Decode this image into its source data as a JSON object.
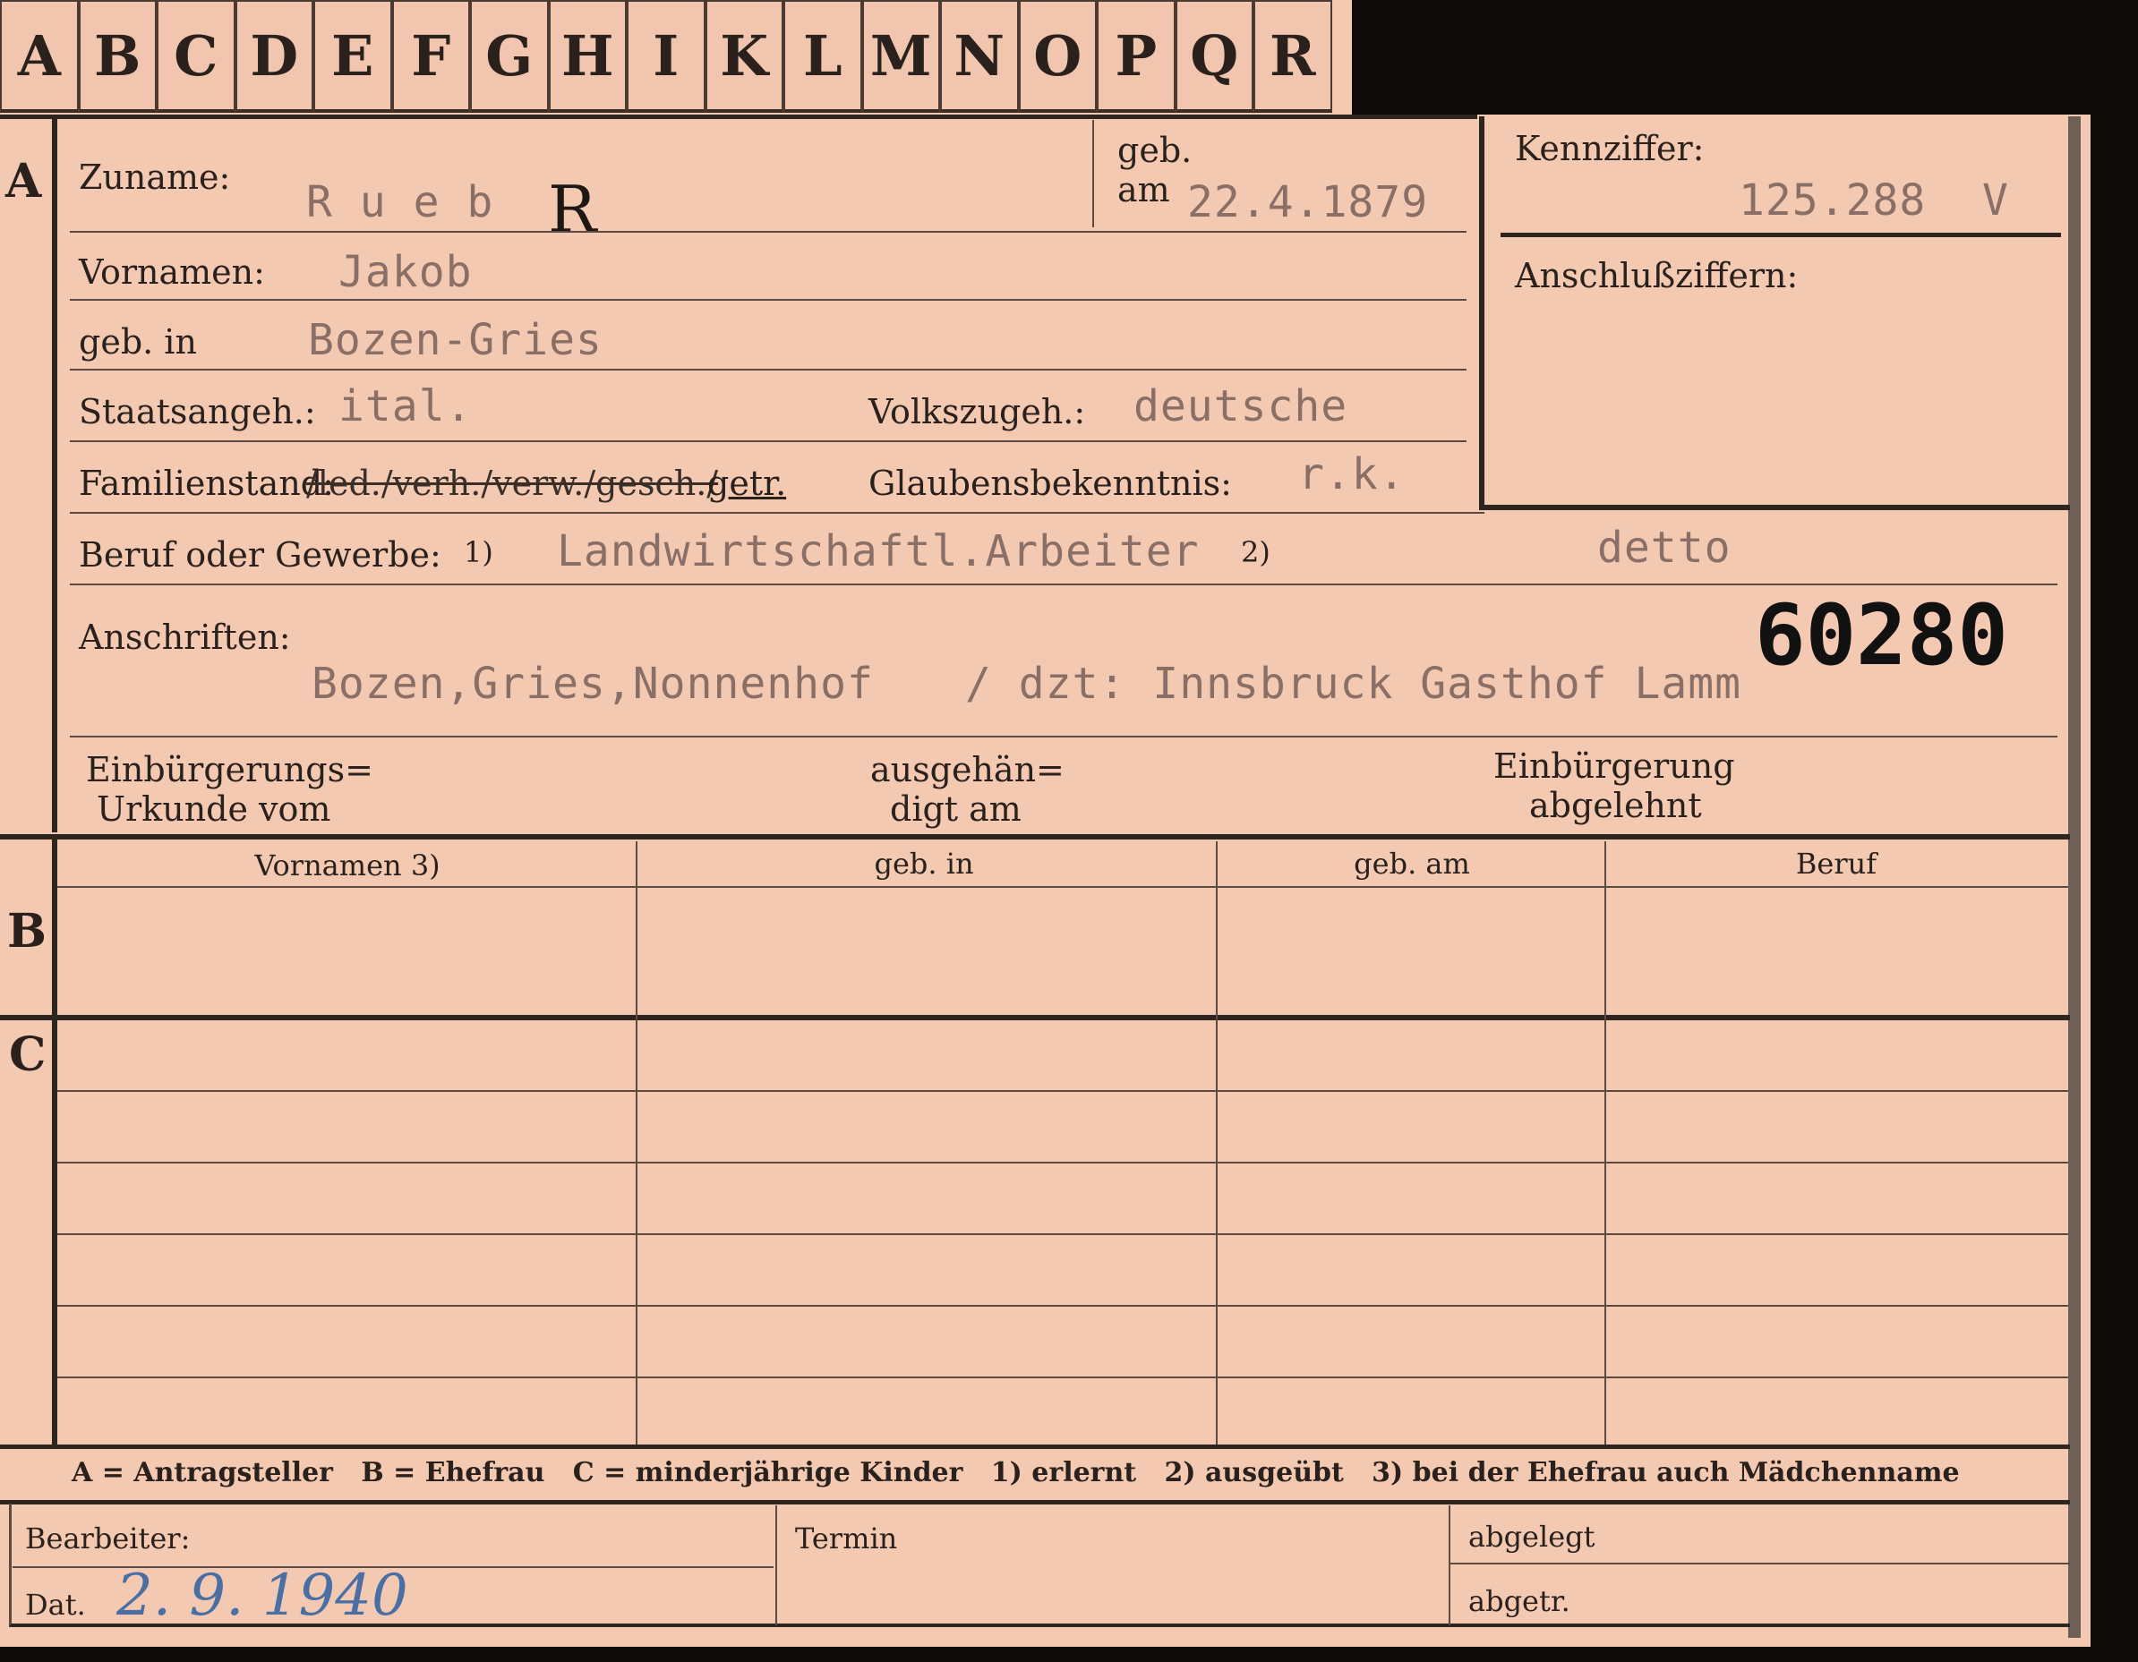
{
  "tabs": [
    "A",
    "B",
    "C",
    "D",
    "E",
    "F",
    "G",
    "H",
    "I",
    "K",
    "L",
    "M",
    "N",
    "O",
    "P",
    "Q",
    "R"
  ],
  "sections": {
    "a": "A",
    "b": "B",
    "c": "C"
  },
  "card": {
    "surname_label": "Zuname:",
    "surname_value": "R u e b",
    "surname_mark": "R",
    "born_label_1": "geb.",
    "born_label_2": "am",
    "born_date": "22.4.1879",
    "kennziffer_label": "Kennziffer:",
    "kennziffer_value": "125.288",
    "kennziffer_suffix": "V",
    "anschluss_label": "Anschlußziffern:",
    "firstnames_label": "Vornamen:",
    "firstnames_value": "Jakob",
    "birthplace_label": "geb. in",
    "birthplace_value": "Bozen-Gries",
    "citizenship_label": "Staatsangeh.:",
    "citizenship_value": "ital.",
    "ethnicity_label": "Volkszugeh.:",
    "ethnicity_value": "deutsche",
    "family_label": "Familienstand:",
    "family_options": "/led./verh./verw./gesch./",
    "family_value": "getr.",
    "religion_label": "Glaubensbekenntnis:",
    "religion_value": "r.k.",
    "occupation_label": "Beruf oder Gewerbe:",
    "occupation_note1": "1)",
    "occupation_value": "Landwirtschaftl.Arbeiter",
    "occupation_note2": "2)",
    "occupation_value2": "detto",
    "address_label": "Anschriften:",
    "address_number": "60280",
    "address_value": "Bozen,Gries,Nonnenhof",
    "address_value2": "/ dzt: Innsbruck Gasthof Lamm",
    "naturalization_label_1": "Einbürgerungs=",
    "naturalization_label_2": "Urkunde vom",
    "handed_label_1": "ausgehän=",
    "handed_label_2": "digt am",
    "refused_label_1": "Einbürgerung",
    "refused_label_2": "abgelehnt"
  },
  "table_headers": [
    "Vornamen 3)",
    "geb. in",
    "geb. am",
    "Beruf"
  ],
  "legend": "A = Antragsteller   B = Ehefrau   C = minderjährige Kinder   1) erlernt   2) ausgeübt   3) bei der Ehefrau auch Mädchenname",
  "footer": {
    "bearbeiter_label": "Bearbeiter:",
    "dat_label": "Dat.",
    "dat_value": "2. 9. 1940",
    "termin_label": "Termin",
    "abgelegt_label": "abgelegt",
    "abgetr_label": "abgetr."
  },
  "colors": {
    "card": "#f4c9b2",
    "ink": "#2a211c",
    "typed": "#8a6f66",
    "handwriting": "#4a6fa5"
  }
}
